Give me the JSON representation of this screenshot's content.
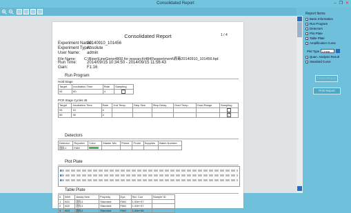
{
  "window": {
    "title": "Consolidated Report"
  },
  "toolbar": {
    "icons": [
      "zoom-in-icon",
      "zoom-out-icon",
      "fit-page-icon",
      "single-page-icon",
      "multi-page-icon",
      "layout-icon"
    ]
  },
  "report": {
    "title": "Consolidated Report",
    "page": "1 / 4",
    "fields": [
      {
        "k": "Experiment Name:",
        "v": "20140910_101456"
      },
      {
        "k": "Experiment Type:",
        "v": "Absolute"
      },
      {
        "k": "User Name:",
        "v": "admin"
      },
      {
        "k": "File Name:",
        "v": "C:\\Bioer\\LineGene4800 for research\\4840\\experiment\\病毒20140910_101456.fqd"
      },
      {
        "k": "Run Time:",
        "v": "2014/09/15 10:34:50 - 2014/09/15 11:56:43"
      },
      {
        "k": "Gain:",
        "v": "F1:16"
      }
    ],
    "run_program": {
      "heading": "Run Program",
      "hold_label": "Hold Stage",
      "hold_headers": [
        "Target",
        "Incubation Time",
        "Rate",
        "Sampling"
      ],
      "hold_rows": [
        [
          "94",
          "60",
          "4",
          ""
        ]
      ],
      "pcr_label": "PCR Stage   Cycles:45",
      "pcr_headers": [
        "Target",
        "Incubation Time",
        "Rate",
        "2nd Temp.",
        "Step Size",
        "Step Delay",
        "Grad Temp.",
        "Grad Range",
        "Sampling"
      ],
      "pcr_rows": [
        [
          "94",
          "10",
          "4",
          "",
          "",
          "",
          "",
          "",
          ""
        ],
        [
          "55",
          "30",
          "4",
          "",
          "",
          "",
          "",
          "",
          "✓"
        ]
      ]
    },
    "detectors": {
      "heading": "Detectors",
      "headers": [
        "Detector",
        "Reporter",
        "Color",
        "Master Mix",
        "Primer",
        "Probe",
        "Supplies",
        "Batch Number"
      ],
      "row": [
        "团队1",
        "FAM",
        "",
        "",
        "",
        "",
        "",
        ""
      ],
      "color": "#4caf50"
    },
    "plot_plate": {
      "heading": "Plot Plate"
    },
    "table_plate": {
      "heading": "Table Plate",
      "headers": [
        "#",
        "Well",
        "Assay Item",
        "Property",
        "Dye",
        "Std. Con",
        "Sample ID"
      ],
      "rows": [
        [
          "1",
          "A01",
          "团队1",
          "Standard",
          "FAM",
          "1.00e+07",
          ""
        ],
        [
          "2",
          "A02",
          "团队1",
          "Standard",
          "FAM",
          "1.00e+07",
          ""
        ],
        [
          "3",
          "A03",
          "团队1",
          "Standard",
          "FAM",
          "1.00e+06",
          ""
        ]
      ]
    }
  },
  "panel": {
    "title": "Report Items",
    "items": [
      {
        "label": "Basic Information",
        "checked": "✓"
      },
      {
        "label": "Run Program",
        "checked": "✓"
      },
      {
        "label": "Detectors",
        "checked": "✓"
      },
      {
        "label": "Plot Plate",
        "checked": "✓"
      },
      {
        "label": "Table Plate",
        "checked": "✓"
      },
      {
        "label": "Amplification Curve",
        "checked": "✓"
      },
      {
        "label": "Quan. Analysis Result",
        "checked": "✓"
      },
      {
        "label": "Standard Curve",
        "checked": "✓"
      }
    ],
    "plot_type_label": "Plot Type",
    "plot_type_value": "Linear",
    "create_button": "Create Report",
    "print_button": "Print Report"
  }
}
